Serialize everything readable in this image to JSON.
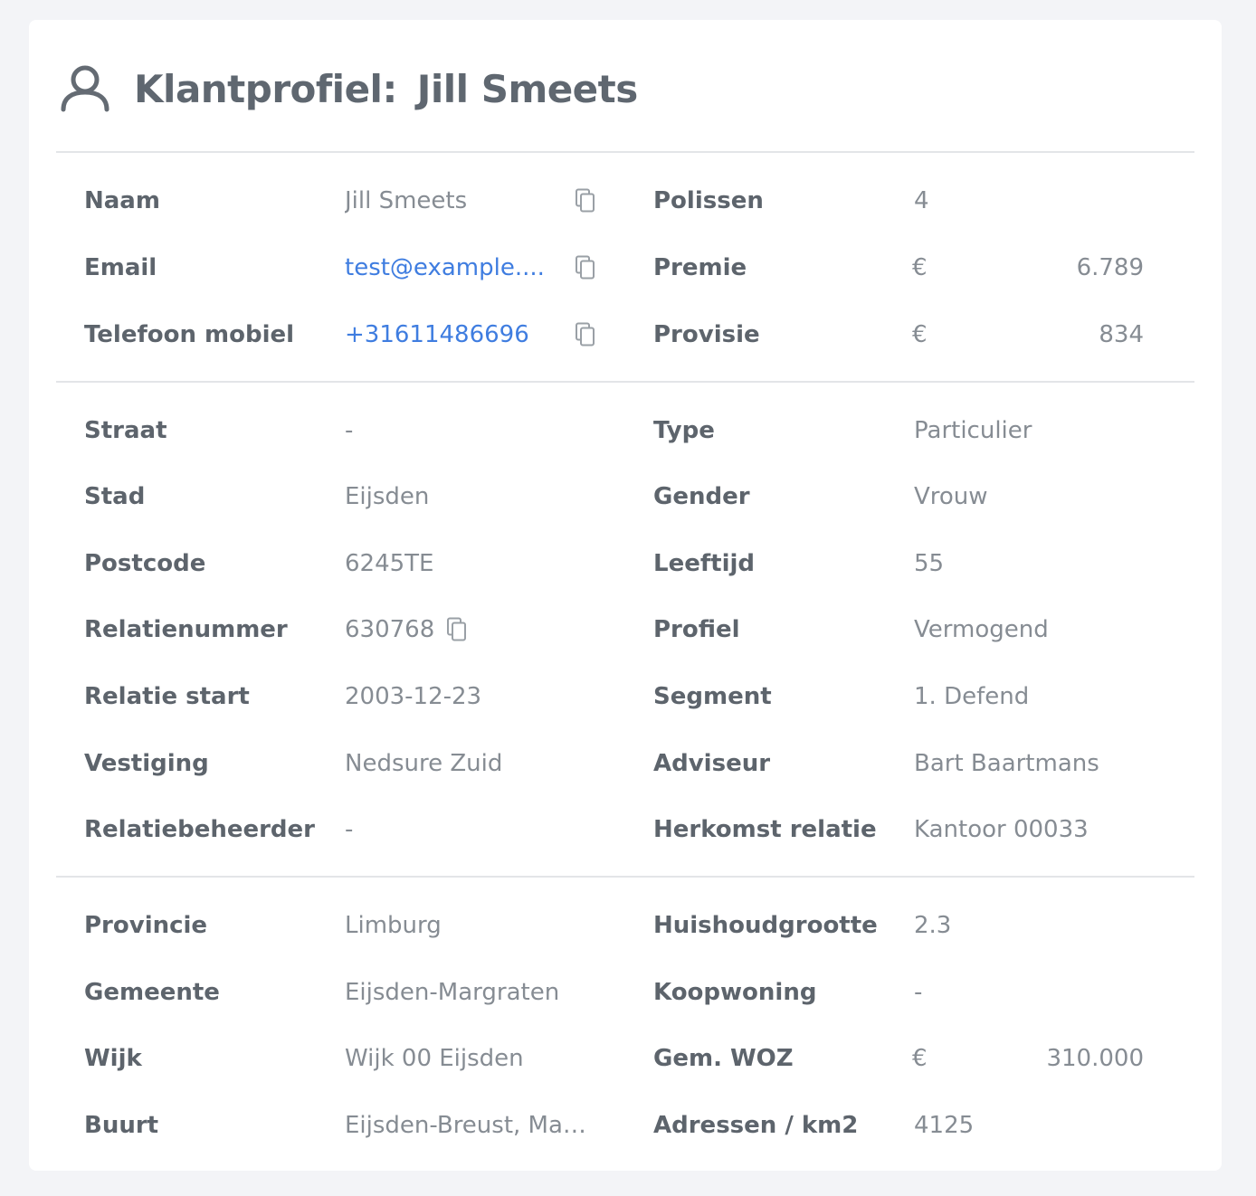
{
  "header": {
    "icon": "user-icon",
    "title_prefix": "Klantprofiel:",
    "customer_name": "Jill Smeets"
  },
  "contact": {
    "name": {
      "label": "Naam",
      "value": "Jill Smeets"
    },
    "email": {
      "label": "Email",
      "value": "test@example...."
    },
    "phone": {
      "label": "Telefoon mobiel",
      "value": "+31611486696"
    },
    "policies": {
      "label": "Polissen",
      "value": "4"
    },
    "premium": {
      "label": "Premie",
      "currency": "€",
      "value": "6.789"
    },
    "commission": {
      "label": "Provisie",
      "currency": "€",
      "value": "834"
    }
  },
  "details": {
    "left": [
      {
        "label": "Straat",
        "value": "-"
      },
      {
        "label": "Stad",
        "value": "Eijsden"
      },
      {
        "label": "Postcode",
        "value": "6245TE"
      },
      {
        "label": "Relatienummer",
        "value": "630768"
      },
      {
        "label": "Relatie start",
        "value": "2003-12-23"
      },
      {
        "label": "Vestiging",
        "value": "Nedsure Zuid"
      },
      {
        "label": "Relatiebeheerder",
        "value": "-"
      }
    ],
    "right": [
      {
        "label": "Type",
        "value": "Particulier"
      },
      {
        "label": "Gender",
        "value": "Vrouw"
      },
      {
        "label": "Leeftijd",
        "value": "55"
      },
      {
        "label": "Profiel",
        "value": "Vermogend"
      },
      {
        "label": "Segment",
        "value": "1. Defend"
      },
      {
        "label": "Adviseur",
        "value": "Bart Baartmans"
      },
      {
        "label": "Herkomst relatie",
        "value": "Kantoor 00033"
      }
    ]
  },
  "region": {
    "left": [
      {
        "label": "Provincie",
        "value": "Limburg"
      },
      {
        "label": "Gemeente",
        "value": "Eijsden-Margraten"
      },
      {
        "label": "Wijk",
        "value": "Wijk 00 Eijsden"
      },
      {
        "label": "Buurt",
        "value": "Eijsden-Breust, Maa..."
      }
    ],
    "right": [
      {
        "label": "Huishoudgrootte",
        "value": "2.3"
      },
      {
        "label": "Koopwoning",
        "value": "-"
      },
      {
        "label": "Gem. WOZ",
        "currency": "€",
        "value": "310.000"
      },
      {
        "label": "Adressen / km2",
        "value": "4125"
      }
    ]
  },
  "colors": {
    "label": "#5d646c",
    "value": "#868c93",
    "link": "#3f7de0",
    "divider": "#e3e5e8",
    "background": "#f3f4f7"
  }
}
